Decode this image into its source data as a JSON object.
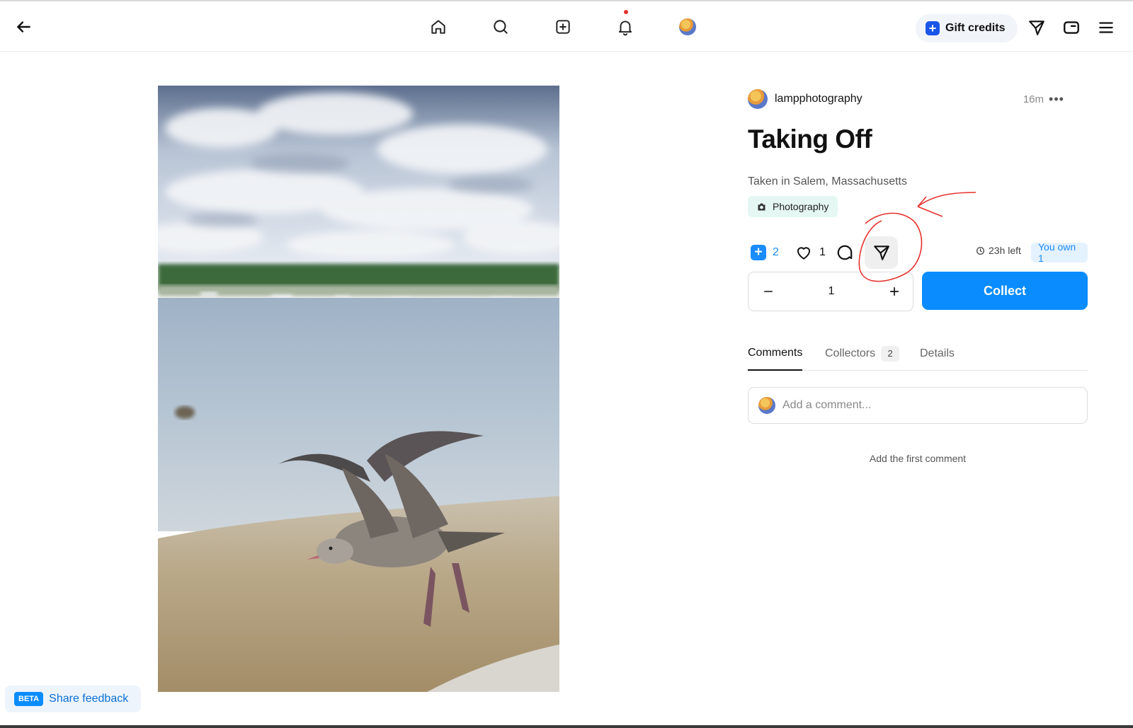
{
  "nav": {
    "gift_label": "Gift credits"
  },
  "post": {
    "author": "lampphotography",
    "time_ago": "16m",
    "title": "Taking Off",
    "description": "Taken in Salem, Massachusetts",
    "tag": "Photography",
    "remix_count": "2",
    "like_count": "1",
    "time_left": "23h left",
    "owned": "You own 1"
  },
  "purchase": {
    "quantity": "1",
    "collect_label": "Collect"
  },
  "tabs": [
    {
      "label": "Comments",
      "count": ""
    },
    {
      "label": "Collectors",
      "count": "2"
    },
    {
      "label": "Details",
      "count": ""
    }
  ],
  "comments": {
    "placeholder": "Add a comment...",
    "empty_text": "Add the first comment"
  },
  "feedback": {
    "badge": "BETA",
    "label": "Share feedback"
  },
  "colors": {
    "accent": "#0a8cff",
    "annotation": "#e5322d"
  },
  "icons": [
    "back-arrow-icon",
    "home-icon",
    "search-icon",
    "create-icon",
    "bell-icon",
    "send-icon",
    "wallet-icon",
    "menu-icon",
    "camera-icon",
    "heart-icon",
    "comment-icon",
    "clock-icon"
  ]
}
